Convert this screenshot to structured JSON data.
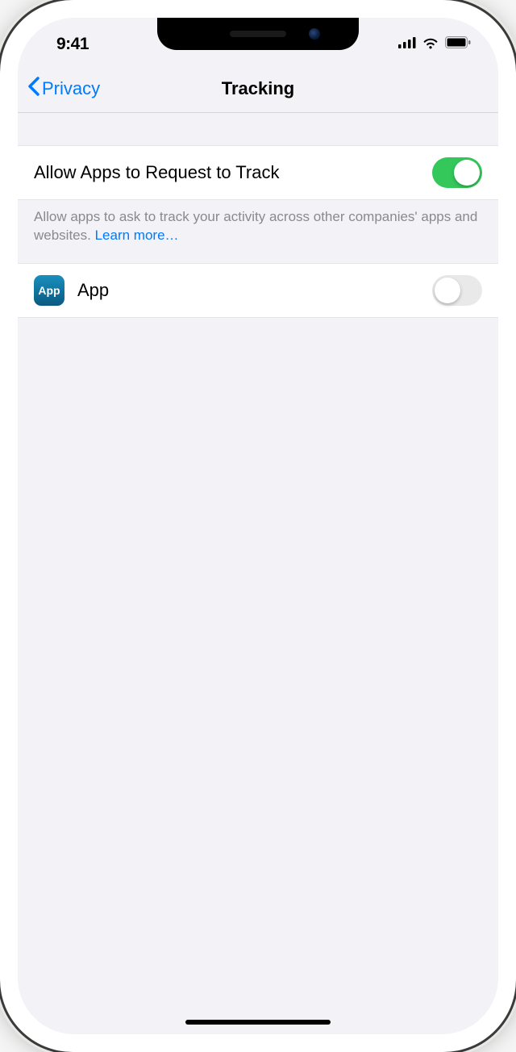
{
  "status": {
    "time": "9:41"
  },
  "nav": {
    "back_label": "Privacy",
    "title": "Tracking"
  },
  "allow": {
    "label": "Allow Apps to Request to Track",
    "enabled": true,
    "footer_text": "Allow apps to ask to track your activity across other companies' apps and websites. ",
    "learn_more_label": "Learn more…"
  },
  "apps": [
    {
      "name": "App",
      "icon_text": "App",
      "tracking_enabled": false
    }
  ]
}
